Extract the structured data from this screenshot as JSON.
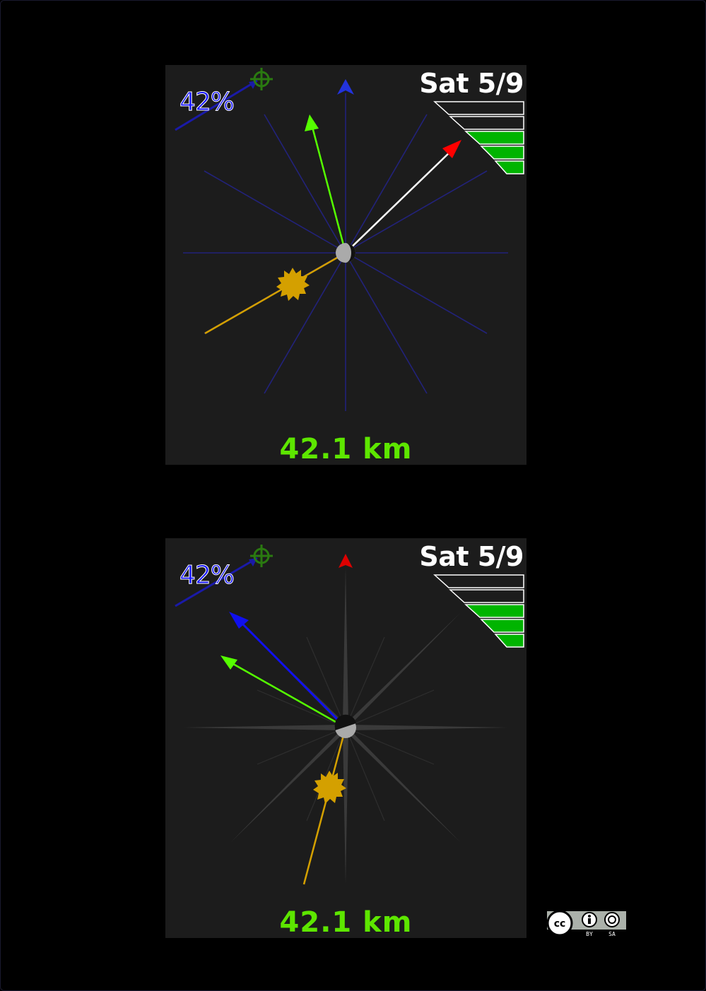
{
  "colors": {
    "background": "#000000",
    "panel": "#1c1c1c",
    "date": "#ffffff",
    "distance": "#5de600",
    "percent": "#1414ff",
    "signal_on": "#00b400",
    "sun": "#d4a000",
    "target_arrow": "#55ff00"
  },
  "panels": [
    {
      "date": "Sat 5/9",
      "percent": "42%",
      "distance": "42.1 km",
      "signal": {
        "bars_total": 5,
        "bars_on": 3
      },
      "icons": [
        "crosshair-icon",
        "north-arrow-icon",
        "sun-icon",
        "moon-icon",
        "satellite-icon"
      ]
    },
    {
      "date": "Sat 5/9",
      "percent": "42%",
      "distance": "42.1 km",
      "signal": {
        "bars_total": 5,
        "bars_on": 3
      },
      "icons": [
        "crosshair-icon",
        "north-arrow-icon",
        "sun-icon",
        "moon-icon",
        "satellite-icon"
      ]
    }
  ],
  "license": {
    "cc": "cc",
    "by": "BY",
    "sa": "SA"
  }
}
